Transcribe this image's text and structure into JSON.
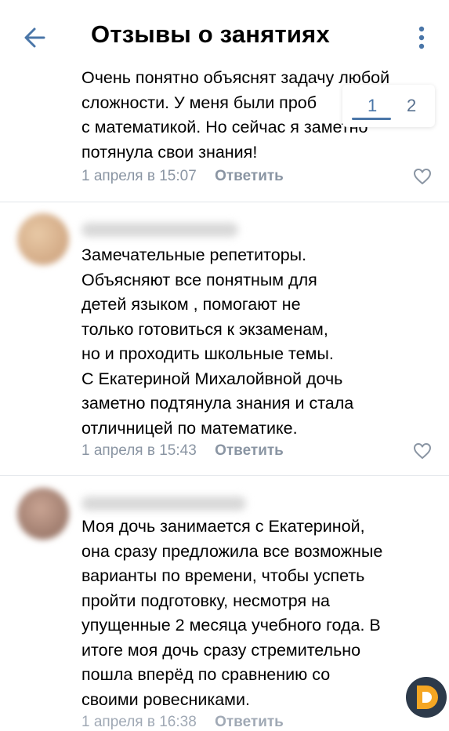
{
  "header": {
    "title": "Отзывы о занятиях"
  },
  "pagination": {
    "page1": "1",
    "page2": "2"
  },
  "reviews": [
    {
      "lines": [
        "Очень понятно объяснят задачу любой",
        "сложности. У меня были проб",
        "с математикой. Но сейчас я заметно",
        "потянула свои знания!"
      ],
      "date": "1 апреля в 15:07",
      "reply": "Ответить"
    },
    {
      "lines": [
        "Замечательные репетиторы.",
        "Объясняют все понятным для",
        "детей языком , помогают не",
        "только готовиться к экзаменам,",
        "но и проходить школьные темы.",
        "С Екатериной Михалойвной дочь",
        "заметно подтянула знания и стала",
        "отличницей по математике."
      ],
      "date": "1 апреля в 15:43",
      "reply": "Ответить"
    },
    {
      "lines": [
        "Моя дочь занимается с Екатериной,",
        "она сразу предложила все возможные",
        "варианты по времени, чтобы успеть",
        "пройти подготовку, несмотря на",
        "упущенные 2 месяца учебного года. В",
        "итоге моя дочь  сразу стремительно",
        "пошла вперёд по сравнению со",
        "своими ровесниками."
      ],
      "date": "1 апреля в 16:38",
      "reply": "Ответить"
    }
  ],
  "colors": {
    "accent": "#4a76a8",
    "meta": "#8a95a3",
    "logo_orange": "#f5a623",
    "logo_dark": "#2d3a4a"
  }
}
